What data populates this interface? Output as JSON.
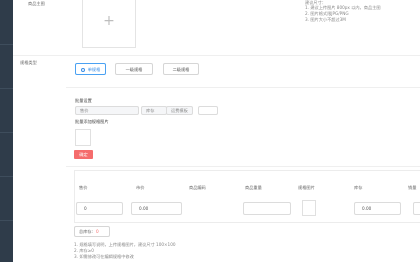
{
  "form": {
    "main_image_label": "商品主图",
    "main_image_plus": "+",
    "hints": [
      "建议尺寸：",
      "1. 建议上传图片 800px 以内，商品主图",
      "2. 图片格式限JPG/PNG",
      "3. 图片大小不超过3M"
    ],
    "spec_label": "规格类型",
    "spec_options": [
      "单规格",
      "一级规格",
      "二级规格"
    ],
    "spec_selected": 0,
    "batch": {
      "title": "批量设置",
      "fields": [
        {
          "placeholder": "售价"
        },
        {
          "placeholder": "库存"
        },
        {
          "placeholder": "运费模板"
        }
      ],
      "extra_field": {
        "placeholder": ""
      },
      "image_title": "批量添加规格图片",
      "confirm_label": "确定"
    },
    "table": {
      "headers": [
        "售价",
        "市价",
        "商品编码",
        "商品重量",
        "规格图片",
        "库存",
        "销量"
      ],
      "row": {
        "price": "0",
        "market_price": "0.00",
        "code": "",
        "weight": "",
        "stock": "0.00",
        "sales": ""
      }
    },
    "total": {
      "label": "总库存:",
      "value": "0"
    },
    "notes": [
      "1. 规格填写说明，上传规格图片，建议尺寸 100×100",
      "2. 库存≥0",
      "3. 如需修改可在编辑规格中修改"
    ],
    "notes_highlight": "规格"
  }
}
